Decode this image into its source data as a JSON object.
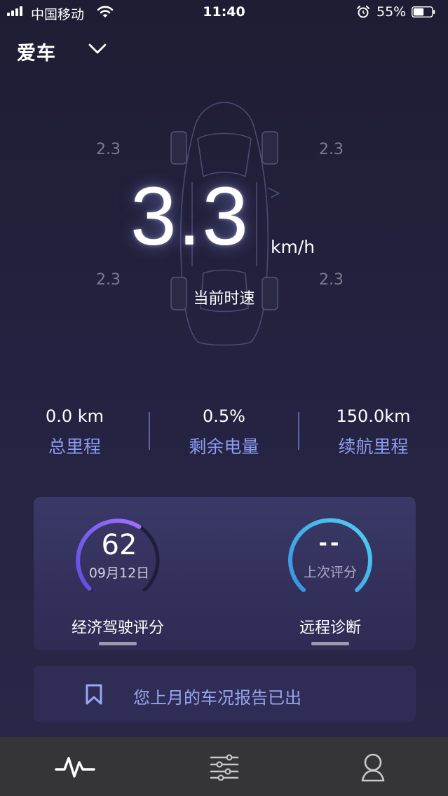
{
  "status_bar": {
    "carrier": "中国移动",
    "time": "11:40",
    "battery_percent": "55%",
    "battery_level": 0.55,
    "icons": [
      "signal-icon",
      "wifi-icon",
      "alarm-icon",
      "battery-icon"
    ]
  },
  "header": {
    "title": "爱车",
    "dropdown_icon": "chevron-down-icon"
  },
  "hero": {
    "speed": "3.3",
    "unit": "km/h",
    "label": "当前时速",
    "tire_pressure": {
      "front_left": "2.3",
      "front_right": "2.3",
      "rear_left": "2.3",
      "rear_right": "2.3"
    }
  },
  "stats": [
    {
      "value": "0.0 km",
      "label": "总里程"
    },
    {
      "value": "0.5%",
      "label": "剩余电量"
    },
    {
      "value": "150.0km",
      "label": "续航里程"
    }
  ],
  "eco_drive": {
    "score": "62",
    "date": "09月12日",
    "label": "经济驾驶评分",
    "score_fraction": 0.62
  },
  "remote_diagnosis": {
    "score": "--",
    "sublabel": "上次评分",
    "label": "远程诊断"
  },
  "report_banner": {
    "text": "您上月的车况报告已出",
    "icon": "bookmark-icon"
  },
  "tab_bar": {
    "tabs": [
      {
        "icon": "activity-icon",
        "active": true
      },
      {
        "icon": "sliders-icon",
        "active": false
      },
      {
        "icon": "user-icon",
        "active": false
      }
    ]
  },
  "colors": {
    "accent_blue": "#8c9bf0",
    "eco_gauge_start": "#5d4fe0",
    "eco_gauge_end": "#a070ff",
    "diag_gauge_start": "#3a8fe0",
    "diag_gauge_end": "#4fd2f0",
    "tab_bar_bg": "#353538"
  }
}
